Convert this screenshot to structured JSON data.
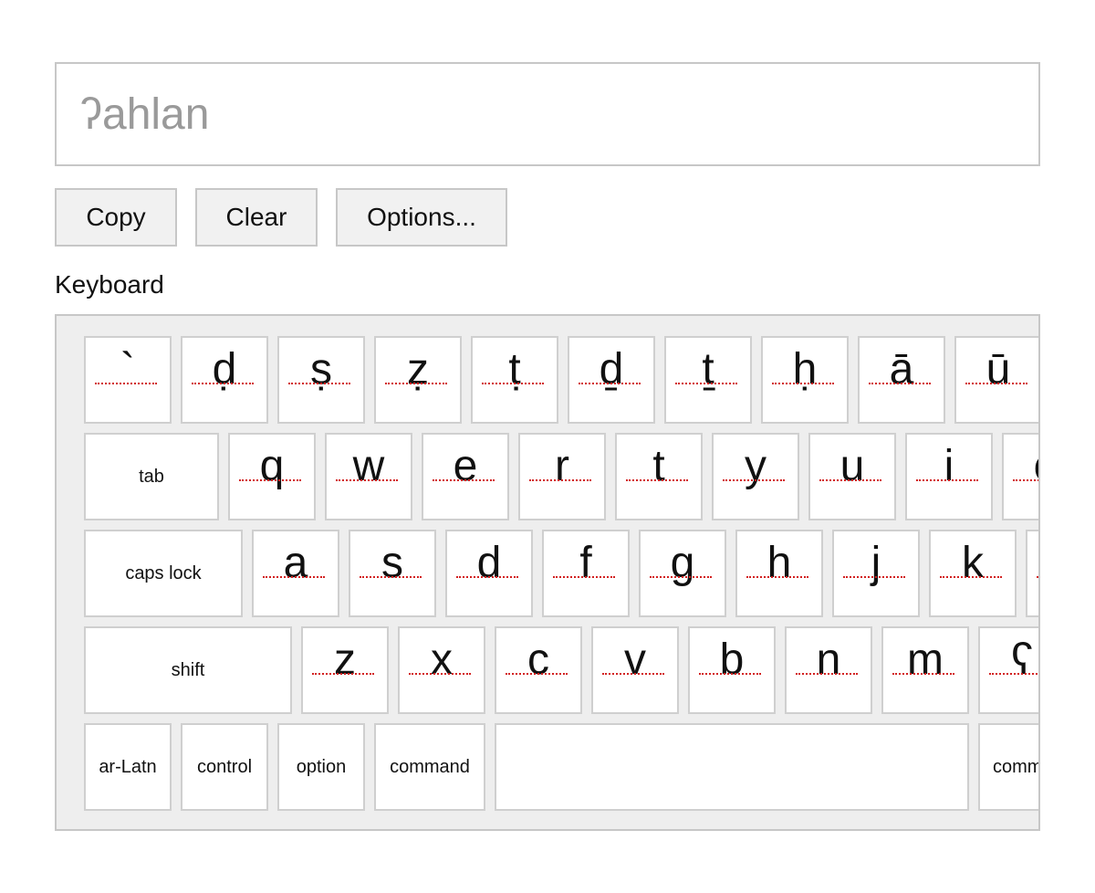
{
  "input": {
    "placeholder": "ʔahlan",
    "value": ""
  },
  "buttons": {
    "copy": "Copy",
    "clear": "Clear",
    "options": "Options..."
  },
  "keyboard_label": "Keyboard",
  "keyboard": {
    "row1": [
      "`",
      "ḍ",
      "ṣ",
      "ẓ",
      "ṭ",
      "ḏ",
      "ṯ",
      "ḥ",
      "ā",
      "ū"
    ],
    "row2": {
      "modifier": "tab",
      "keys": [
        "q",
        "w",
        "e",
        "r",
        "t",
        "y",
        "u",
        "i",
        "o"
      ]
    },
    "row3": {
      "modifier": "caps lock",
      "keys": [
        "a",
        "s",
        "d",
        "f",
        "g",
        "h",
        "j",
        "k",
        "l"
      ]
    },
    "row4": {
      "modifier": "shift",
      "keys": [
        "z",
        "x",
        "c",
        "v",
        "b",
        "n",
        "m",
        "ʕ"
      ]
    },
    "row5": {
      "lang": "ar-Latn",
      "control": "control",
      "option": "option",
      "command": "command",
      "space": "",
      "command_right": "command"
    }
  },
  "colors": {
    "underline": "#d21f1f",
    "key_border": "#cfcfcf",
    "keyboard_bg": "#eeeeee",
    "button_bg": "#f1f1f1"
  }
}
